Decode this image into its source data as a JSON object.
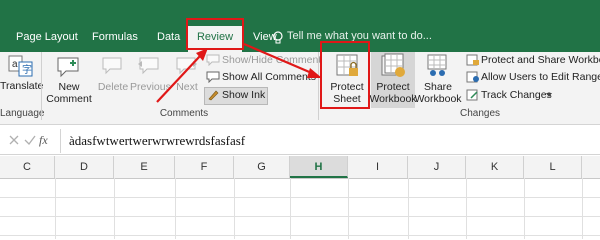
{
  "tabs": [
    {
      "label": "Page Layout"
    },
    {
      "label": "Formulas"
    },
    {
      "label": "Data"
    },
    {
      "label": "Review"
    },
    {
      "label": "View"
    }
  ],
  "tell_me": "Tell me what you want to do...",
  "ribbon": {
    "translate": "Translate",
    "language_group": "Language",
    "new_comment_1": "New",
    "new_comment_2": "Comment",
    "delete": "Delete",
    "previous": "Previous",
    "next": "Next",
    "show_hide_comment": "Show/Hide Comment",
    "show_all_comments": "Show All Comments",
    "show_ink": "Show Ink",
    "comments_group": "Comments",
    "protect_sheet_1": "Protect",
    "protect_sheet_2": "Sheet",
    "protect_workbook_1": "Protect",
    "protect_workbook_2": "Workbook",
    "share_workbook_1": "Share",
    "share_workbook_2": "Workbook",
    "protect_share": "Protect and Share Workbook",
    "allow_users": "Allow Users to Edit Ranges",
    "track_changes": "Track Changes",
    "changes_group": "Changes"
  },
  "formula": {
    "fx": "fx",
    "value": "àdasfwtwertwerwrwrewrdsfasfasf"
  },
  "columns": [
    "C",
    "D",
    "E",
    "F",
    "G",
    "H",
    "I",
    "J",
    "K",
    "L"
  ],
  "selected_column": "H",
  "colors": {
    "accent": "#217346",
    "highlight": "#e01818"
  }
}
